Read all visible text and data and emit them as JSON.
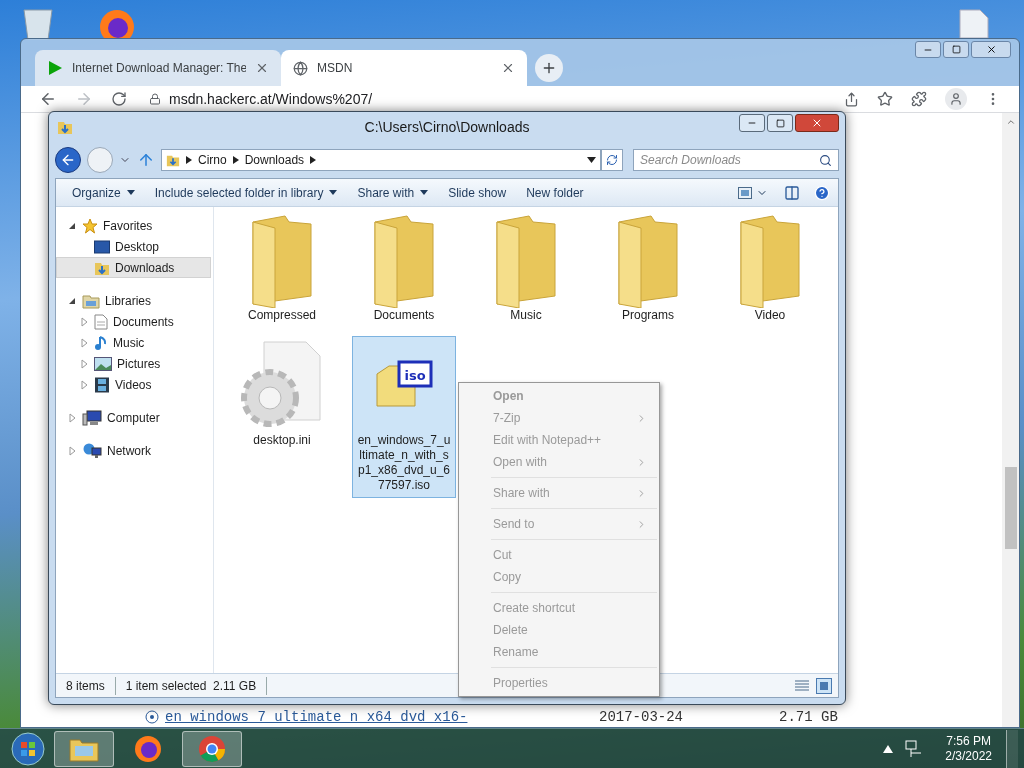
{
  "browser": {
    "tabs": [
      {
        "title": "Internet Download Manager: The",
        "selected": false
      },
      {
        "title": "MSDN",
        "selected": true
      }
    ],
    "url": "msdn.hackerc.at/Windows%207/",
    "page_rows": [
      {
        "name": "en_windows_7_ultimate_n_x64_dvd_x16-",
        "date": "2017-03-24",
        "size": "2.71 GB"
      }
    ]
  },
  "explorer": {
    "title": "C:\\Users\\Cirno\\Downloads",
    "breadcrumb": [
      "Cirno",
      "Downloads"
    ],
    "search": {
      "placeholder": "Search Downloads"
    },
    "toolbar": [
      {
        "label": "Organize",
        "dropdown": true
      },
      {
        "label": "Include selected folder in library",
        "dropdown": true
      },
      {
        "label": "Share with",
        "dropdown": true
      },
      {
        "label": "Slide show",
        "dropdown": false
      },
      {
        "label": "New folder",
        "dropdown": false
      }
    ],
    "nav": [
      {
        "label": "Favorites",
        "kind": "favorites",
        "expanded": true,
        "selected": false,
        "children": [
          {
            "label": "Desktop",
            "kind": "desktop",
            "selected": false
          },
          {
            "label": "Downloads",
            "kind": "downloads",
            "selected": true
          }
        ]
      },
      {
        "label": "Libraries",
        "kind": "libraries",
        "expanded": true,
        "selected": false,
        "children": [
          {
            "label": "Documents",
            "kind": "documents",
            "expanded": false,
            "selected": false
          },
          {
            "label": "Music",
            "kind": "music",
            "expanded": false,
            "selected": false
          },
          {
            "label": "Pictures",
            "kind": "pictures",
            "expanded": false,
            "selected": false
          },
          {
            "label": "Videos",
            "kind": "videos",
            "expanded": false,
            "selected": false
          }
        ]
      },
      {
        "label": "Computer",
        "kind": "computer",
        "expanded": false,
        "selected": false
      },
      {
        "label": "Network",
        "kind": "network",
        "expanded": false,
        "selected": false
      }
    ],
    "items": [
      {
        "name": "Compressed",
        "kind": "folder",
        "selected": false
      },
      {
        "name": "Documents",
        "kind": "folder",
        "selected": false
      },
      {
        "name": "Music",
        "kind": "folder",
        "selected": false
      },
      {
        "name": "Programs",
        "kind": "folder",
        "selected": false
      },
      {
        "name": "Video",
        "kind": "folder",
        "selected": false
      },
      {
        "name": "desktop.ini",
        "kind": "settings",
        "selected": false
      },
      {
        "name": "en_windows_7_ultimate_n_with_sp1_x86_dvd_u_677597.iso",
        "kind": "iso",
        "selected": true
      }
    ],
    "status": {
      "count": "8 items",
      "selection": "1 item selected  2.11 GB"
    }
  },
  "context_menu": {
    "items": [
      {
        "label": "Open",
        "bold": true,
        "submenu": false,
        "separator_before": false
      },
      {
        "label": "7-Zip",
        "bold": false,
        "submenu": true,
        "separator_before": false
      },
      {
        "label": "Edit with Notepad++",
        "bold": false,
        "submenu": false,
        "separator_before": false
      },
      {
        "label": "Open with",
        "bold": false,
        "submenu": true,
        "separator_before": false
      },
      {
        "label": "Share with",
        "bold": false,
        "submenu": true,
        "separator_before": true
      },
      {
        "label": "Send to",
        "bold": false,
        "submenu": true,
        "separator_before": true
      },
      {
        "label": "Cut",
        "bold": false,
        "submenu": false,
        "separator_before": true
      },
      {
        "label": "Copy",
        "bold": false,
        "submenu": false,
        "separator_before": false
      },
      {
        "label": "Create shortcut",
        "bold": false,
        "submenu": false,
        "separator_before": true
      },
      {
        "label": "Delete",
        "bold": false,
        "submenu": false,
        "separator_before": false
      },
      {
        "label": "Rename",
        "bold": false,
        "submenu": false,
        "separator_before": false
      },
      {
        "label": "Properties",
        "bold": false,
        "submenu": false,
        "separator_before": true
      }
    ]
  },
  "taskbar": {
    "apps": [
      {
        "kind": "explorer",
        "selected": true
      },
      {
        "kind": "firefox",
        "selected": false
      },
      {
        "kind": "chrome",
        "selected": true
      }
    ],
    "time": "7:56 PM",
    "date": "2/3/2022"
  }
}
